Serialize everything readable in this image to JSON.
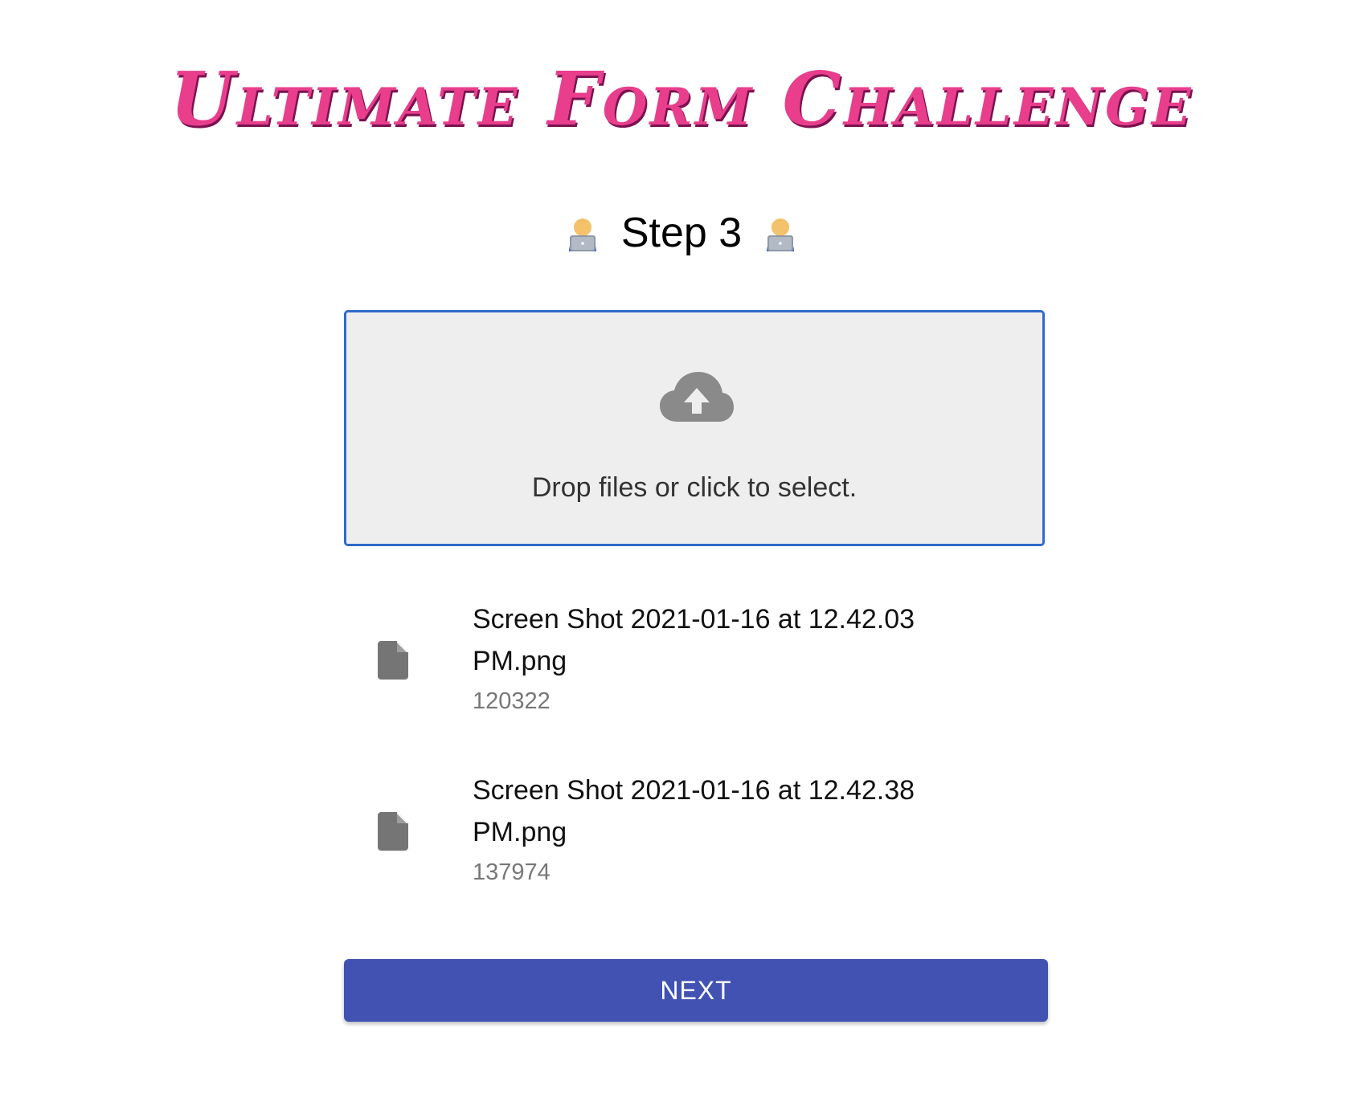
{
  "header": {
    "title": "Ultimate Form Challenge"
  },
  "step": {
    "label": "Step 3",
    "emoji_icon": "woman-technologist-icon"
  },
  "dropzone": {
    "icon": "cloud-upload-icon",
    "hint": "Drop files or click to select."
  },
  "files": [
    {
      "icon": "file-icon",
      "name_line1": "Screen Shot 2021-01-16 at 12.42.03",
      "name_line2": "PM.png",
      "size": "120322"
    },
    {
      "icon": "file-icon",
      "name_line1": "Screen Shot 2021-01-16 at 12.42.38",
      "name_line2": "PM.png",
      "size": "137974"
    }
  ],
  "actions": {
    "next_label": "NEXT"
  },
  "colors": {
    "title": "#e83e8c",
    "dropzone_border": "#2f6bc8",
    "dropzone_bg": "#eeeeee",
    "button_bg": "#4152b3",
    "icon_gray": "#757575"
  }
}
